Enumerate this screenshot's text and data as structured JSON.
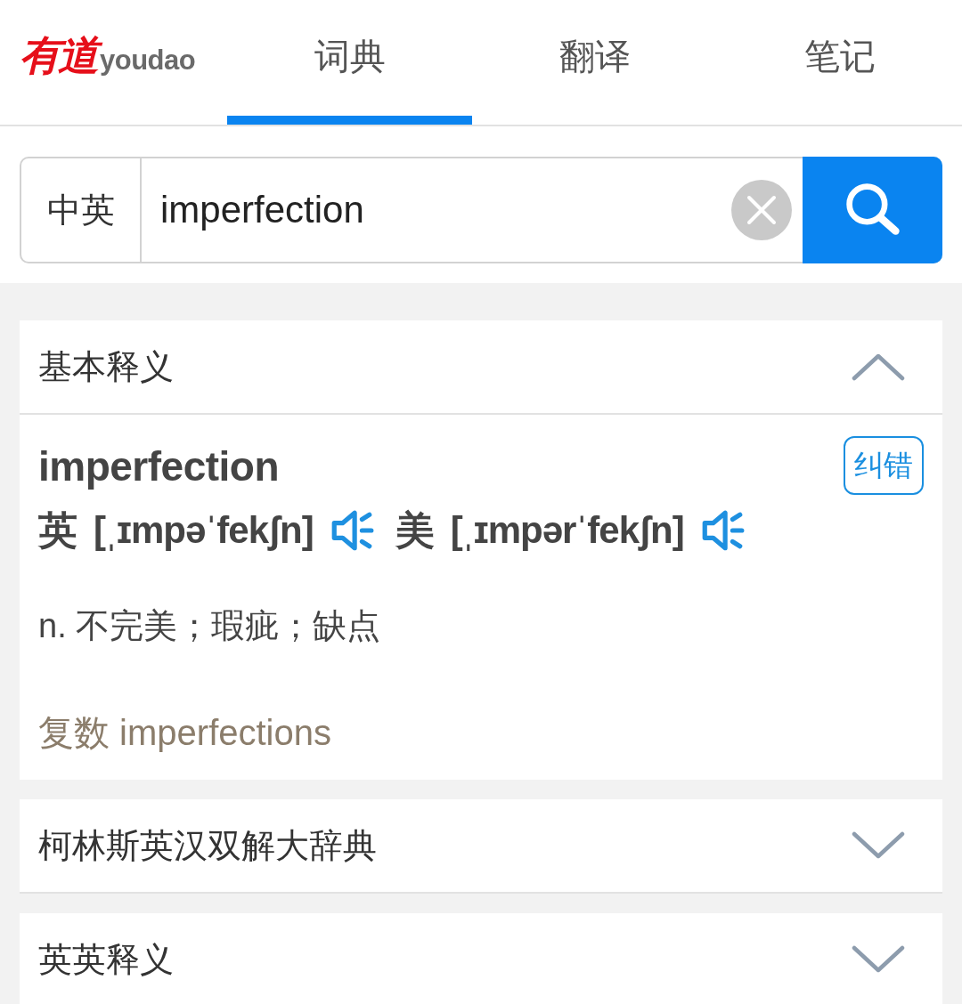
{
  "header": {
    "logo": {
      "chinese": "有道",
      "latin": "youdao"
    },
    "tabs": [
      {
        "label": "词典",
        "selected": true
      },
      {
        "label": "翻译",
        "selected": false
      },
      {
        "label": "笔记",
        "selected": false
      }
    ]
  },
  "search": {
    "language": "中英",
    "value": "imperfection"
  },
  "sections": [
    {
      "title": "基本释义",
      "expanded": true,
      "word": "imperfection",
      "report_button": "纠错",
      "pronunciations": [
        {
          "region": "英",
          "phonetic": "[ˌɪmpəˈfekʃn]"
        },
        {
          "region": "美",
          "phonetic": "[ˌɪmpərˈfekʃn]"
        }
      ],
      "definitions": [
        "n. 不完美；瑕疵；缺点"
      ],
      "inflections": [
        "复数 imperfections"
      ]
    },
    {
      "title": "柯林斯英汉双解大辞典",
      "expanded": false
    },
    {
      "title": "英英释义",
      "expanded": false
    }
  ]
}
